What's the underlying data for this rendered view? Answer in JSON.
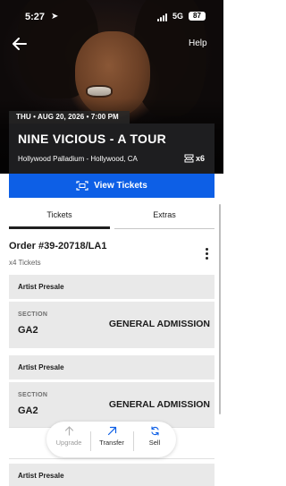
{
  "status": {
    "time": "5:27",
    "network": "5G",
    "battery": "87"
  },
  "nav": {
    "help_label": "Help"
  },
  "event": {
    "date_line": "THU • AUG 20, 2026 • 7:00 PM",
    "title": "NINE VICIOUS - A TOUR",
    "venue": "Hollywood Palladium - Hollywood, CA",
    "ticket_count": "x6"
  },
  "view_tickets_label": "View Tickets",
  "tabs": [
    {
      "label": "Tickets"
    },
    {
      "label": "Extras"
    }
  ],
  "order": {
    "title": "Order #39-20718/LA1",
    "subtitle": "x4 Tickets"
  },
  "tickets": [
    {
      "presale": "Artist Presale",
      "section_label": "SECTION",
      "section": "GA2",
      "admission": "GENERAL ADMISSION"
    },
    {
      "presale": "Artist Presale",
      "section_label": "SECTION",
      "section": "GA2",
      "admission": "GENERAL ADMISSION"
    },
    {
      "presale": "Artist Presale"
    }
  ],
  "actions": [
    {
      "label": "Upgrade",
      "icon": "arrow-up-icon",
      "enabled": false
    },
    {
      "label": "Transfer",
      "icon": "arrow-up-right-icon",
      "enabled": true
    },
    {
      "label": "Sell",
      "icon": "refresh-icon",
      "enabled": true
    }
  ],
  "colors": {
    "accent": "#0d5fe6",
    "info_bg": "#1e1e20",
    "card_bg": "#e9e9e9"
  }
}
